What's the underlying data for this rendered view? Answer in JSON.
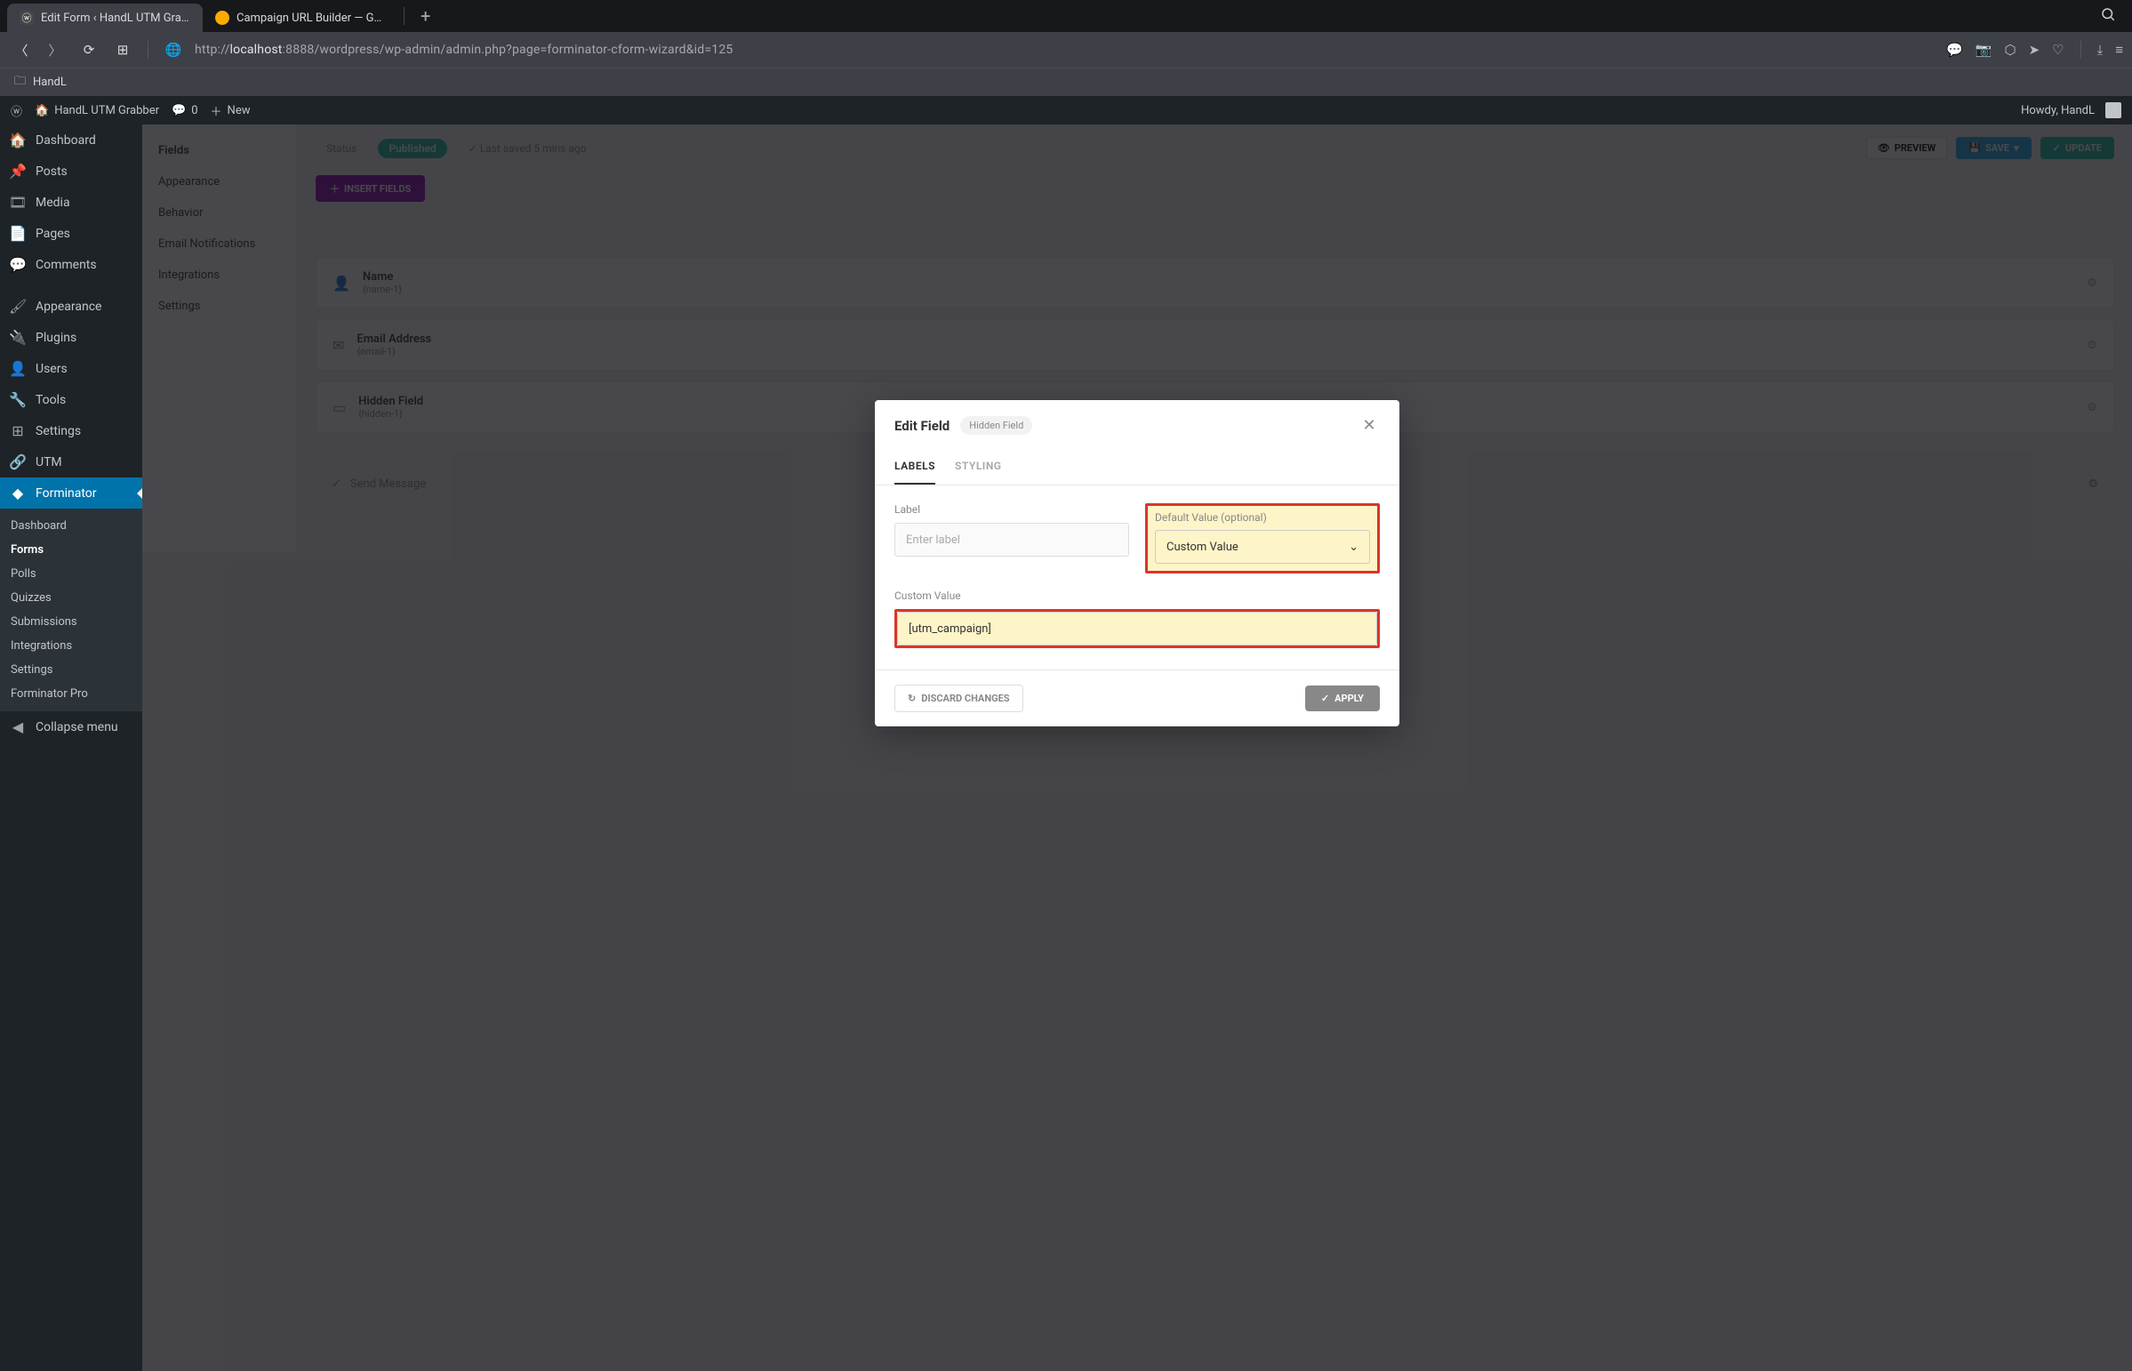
{
  "browser": {
    "tabs": [
      {
        "title": "Edit Form ‹ HandL UTM Grabbe",
        "favicon": "wp"
      },
      {
        "title": "Campaign URL Builder — Googl",
        "favicon": "ga"
      }
    ],
    "url_prefix": "http://",
    "url_host": "localhost",
    "url_rest": ":8888/wordpress/wp-admin/admin.php?page=forminator-cform-wizard&id=125",
    "bookmark": "HandL"
  },
  "wp_bar": {
    "site": "HandL UTM Grabber",
    "comments": "0",
    "new": "New",
    "howdy": "Howdy, HandL"
  },
  "adminmenu": {
    "items": [
      {
        "icon": "⏱",
        "label": "Dashboard"
      },
      {
        "icon": "📌",
        "label": "Posts"
      },
      {
        "icon": "🎞",
        "label": "Media"
      },
      {
        "icon": "📄",
        "label": "Pages"
      },
      {
        "icon": "💬",
        "label": "Comments"
      },
      {
        "icon": "🖌",
        "label": "Appearance"
      },
      {
        "icon": "🔌",
        "label": "Plugins"
      },
      {
        "icon": "👤",
        "label": "Users"
      },
      {
        "icon": "🔧",
        "label": "Tools"
      },
      {
        "icon": "⚙",
        "label": "Settings"
      },
      {
        "icon": "🔗",
        "label": "UTM"
      },
      {
        "icon": "◆",
        "label": "Forminator"
      }
    ],
    "submenu": [
      "Dashboard",
      "Forms",
      "Polls",
      "Quizzes",
      "Submissions",
      "Integrations",
      "Settings",
      "Forminator Pro"
    ],
    "collapse": "Collapse menu"
  },
  "side_panel": {
    "items": [
      "Fields",
      "Appearance",
      "Behavior",
      "Email Notifications",
      "Integrations",
      "Settings"
    ]
  },
  "canvas": {
    "status_label": "Status",
    "status": "Published",
    "last_saved": "Last saved 5 mins ago",
    "preview": "PREVIEW",
    "save": "SAVE",
    "update": "UPDATE",
    "insert": "INSERT FIELDS",
    "fields": [
      {
        "icon": "👤",
        "title": "Name",
        "sub": "{name-1}"
      },
      {
        "icon": "✉",
        "title": "Email Address",
        "sub": "{email-1}"
      },
      {
        "icon": "▭",
        "title": "Hidden Field",
        "sub": "{hidden-1}"
      }
    ],
    "pagination": "Send Message"
  },
  "modal": {
    "title": "Edit Field",
    "badge": "Hidden Field",
    "tabs": {
      "labels": "LABELS",
      "styling": "STYLING"
    },
    "label_label": "Label",
    "label_placeholder": "Enter label",
    "default_label": "Default Value (optional)",
    "default_value": "Custom Value",
    "custom_label": "Custom Value",
    "custom_value": "[utm_campaign]",
    "discard": "DISCARD CHANGES",
    "apply": "APPLY"
  }
}
